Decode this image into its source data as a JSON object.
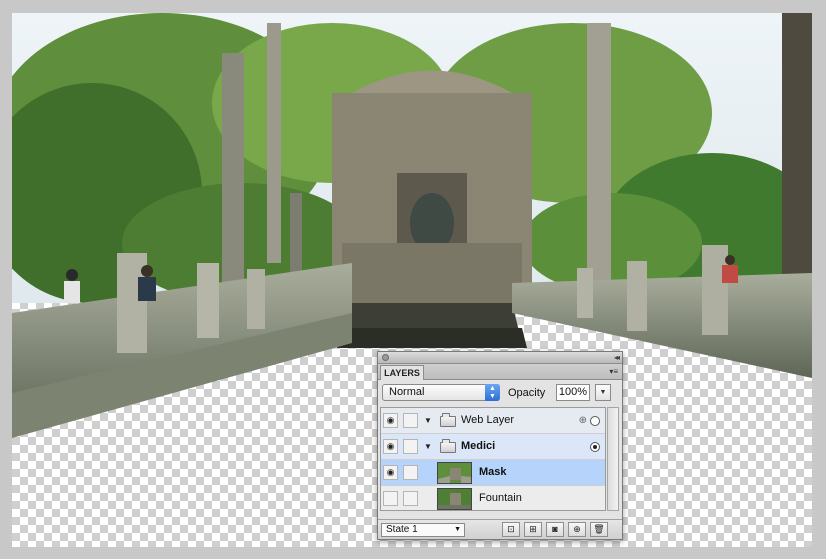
{
  "canvas": {
    "photo_subject": "fountain-garden-photo"
  },
  "layers_panel": {
    "tab_label": "LAYERS",
    "blend_mode": "Normal",
    "opacity_label": "Opacity",
    "opacity_value": "100%",
    "layers": [
      {
        "name": "Web Layer",
        "type": "group",
        "visible": true
      },
      {
        "name": "Medici",
        "type": "group",
        "visible": true
      },
      {
        "name": "Mask",
        "type": "layer",
        "visible": true,
        "selected": true
      },
      {
        "name": "Fountain",
        "type": "layer",
        "visible": false
      }
    ],
    "state_select": "State 1",
    "icons": {
      "eye": "eye-icon",
      "folder": "folder-icon",
      "menu": "panel-menu-icon"
    }
  }
}
